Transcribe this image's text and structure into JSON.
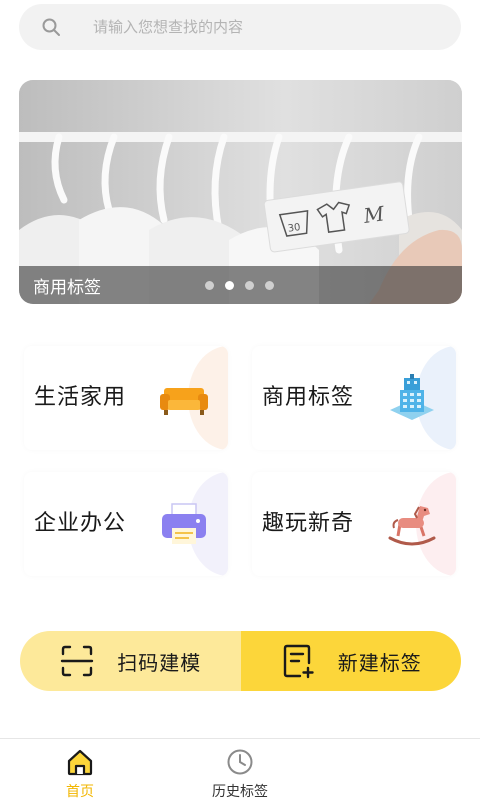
{
  "search": {
    "placeholder": "请输入您想查找的内容",
    "icon": "search-icon"
  },
  "banner": {
    "caption": "商用标签",
    "tag_text": "M",
    "tag_wash_temp": "30",
    "slide_count": 4,
    "active_slide": 2
  },
  "categories": [
    {
      "label": "生活家用",
      "icon": "sofa-icon",
      "tint": "#fdf1e8"
    },
    {
      "label": "商用标签",
      "icon": "building-icon",
      "tint": "#eaf1fb"
    },
    {
      "label": "企业办公",
      "icon": "printer-icon",
      "tint": "#f2f1fb"
    },
    {
      "label": "趣玩新奇",
      "icon": "rocking-horse-icon",
      "tint": "#fdeef0"
    }
  ],
  "actions": {
    "scan_label": "扫码建模",
    "new_label": "新建标签"
  },
  "tabbar": {
    "home_label": "首页",
    "history_label": "历史标签",
    "active": "home"
  },
  "colors": {
    "accent": "#f2b600",
    "scan_bg": "#fde99a",
    "new_bg": "#fcd63a"
  }
}
